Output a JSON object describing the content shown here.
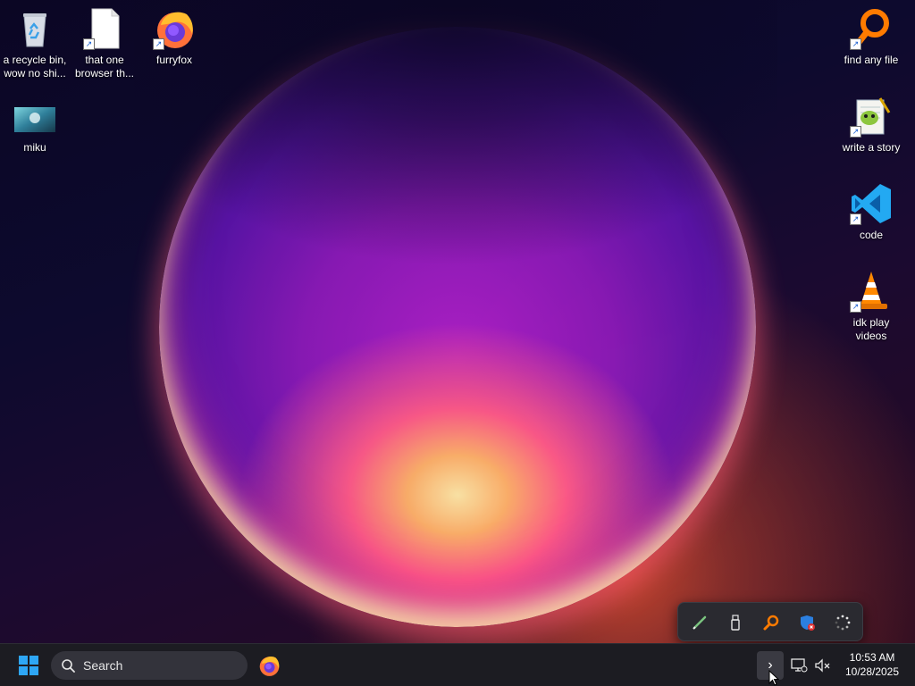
{
  "desktop": {
    "left_icons": [
      {
        "name": "recycle-bin",
        "label": "a recycle bin, wow no shi..."
      },
      {
        "name": "that-one-browser",
        "label": "that one browser th..."
      },
      {
        "name": "furryfox",
        "label": "furryfox"
      },
      {
        "name": "miku",
        "label": "miku"
      }
    ],
    "right_icons": [
      {
        "name": "find-any-file",
        "label": "find any file"
      },
      {
        "name": "write-a-story",
        "label": "write a story"
      },
      {
        "name": "code",
        "label": "code"
      },
      {
        "name": "idk-play-videos",
        "label": "idk play videos"
      }
    ]
  },
  "taskbar": {
    "search_placeholder": "Search",
    "pinned": [
      "firefox-icon"
    ],
    "tray_overflow": [
      "pen-icon",
      "usb-drive-icon",
      "search-tool-icon",
      "defender-shield-icon",
      "loading-spinner-icon"
    ],
    "clock": {
      "time": "10:53 AM",
      "date": "10/28/2025"
    }
  },
  "colors": {
    "taskbar_bg": "#1c1c22",
    "search_bg": "#33333b",
    "accent_blue": "#0a84ff",
    "firefox_orange": "#ff7139",
    "vscode_blue": "#23a9f2"
  }
}
